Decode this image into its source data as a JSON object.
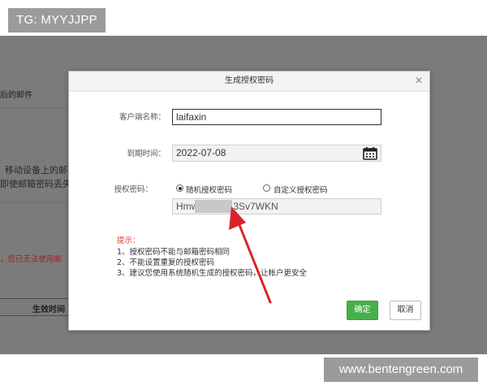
{
  "watermark_top": "TG: MYYJJPP",
  "watermark_bottom": "www.bentengreen.com",
  "background": {
    "mail_label": "后的邮件",
    "mobile_line1": "移动设备上的邮",
    "mobile_line2": "即使邮箱密码丢失",
    "warning": "，您已无法使用邮",
    "col_effective_time": "生效时间"
  },
  "dialog": {
    "title": "生成授权密码",
    "close_icon": "close-icon",
    "client_name_label": "客户端名称：",
    "client_name_value": "laifaxin",
    "expire_label": "到期时间：",
    "expire_value": "2022-07-08",
    "calendar_icon": "calendar-icon",
    "auth_password_label": "授权密码：",
    "radio_random_label": "随机授权密码",
    "radio_custom_label": "自定义授权密码",
    "radio_selected": "random",
    "password_prefix": "Hmw",
    "password_suffix": "3Sv7WKN",
    "tips_title": "提示：",
    "tips": [
      "1、授权密码不能与邮箱密码相同",
      "2、不能设置重复的授权密码",
      "3、建议您使用系统随机生成的授权密码，让帐户更安全"
    ],
    "ok_label": "确定",
    "cancel_label": "取消"
  },
  "colors": {
    "accent_green": "#48b04a",
    "tip_red": "#e03a2d",
    "arrow_red": "#d8232a",
    "overlay_gray": "#7b7b7b"
  }
}
